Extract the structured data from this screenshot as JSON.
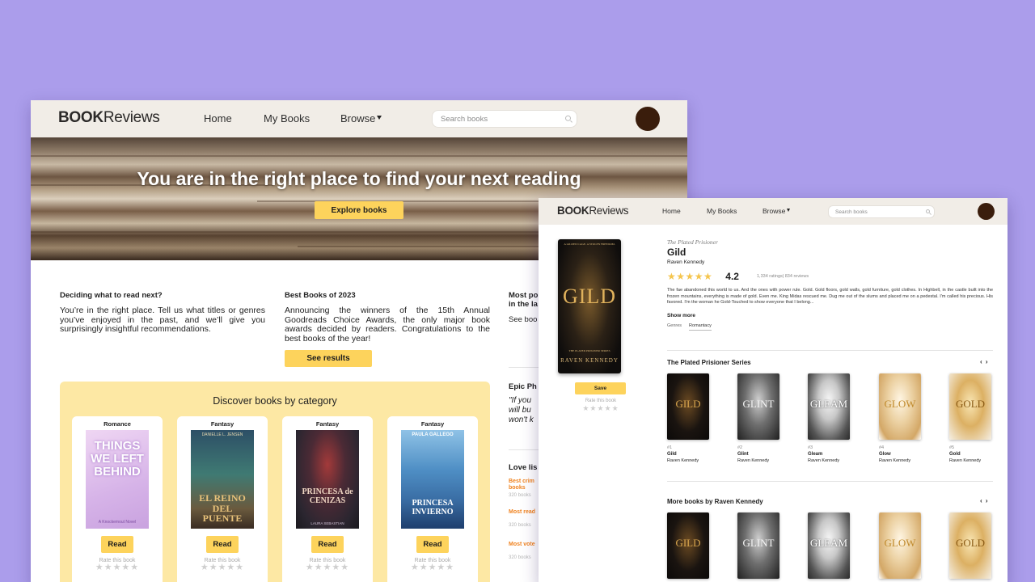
{
  "nav": {
    "logo_bold": "BOOK",
    "logo_rest": "Reviews",
    "home": "Home",
    "my_books": "My Books",
    "browse": "Browse",
    "search_placeholder": "Search books"
  },
  "home": {
    "hero_title": "You are in the right place to find your next reading",
    "explore_button": "Explore books",
    "col1": {
      "heading": "Deciding what to read next?",
      "text": "You’re in the right place. Tell us what titles or genres you’ve enjoyed in the past, and we’ll give you surprisingly insightful recommendations."
    },
    "col2": {
      "heading": "Best Books of 2023",
      "text": "Announcing the winners of the 15th Annual Goodreads Choice Awards, the only major book awards decided by readers. Congratulations to the best books of the year!",
      "button": "See results"
    },
    "col3": {
      "heading": "Most po",
      "heading2": "in the la",
      "text": "See boo"
    },
    "epic": {
      "heading": "Epic Ph",
      "quote1": "\"If you",
      "quote2": "will bu",
      "quote3": "won't k"
    },
    "love": {
      "heading": "Love lis",
      "item1a": "Best crim",
      "item1b": "books",
      "item1c": "320 books",
      "item2a": "Most read",
      "item2c": "320 books",
      "item3a": "Most vote",
      "item3c": "320 books"
    },
    "category": {
      "title": "Discover books by category",
      "read_label": "Read",
      "rate_label": "Rate this book",
      "cards": [
        {
          "genre": "Romance",
          "cover_text": "THINGS WE LEFT BEHIND",
          "cover_sub": "A Knockemout Novel"
        },
        {
          "genre": "Fantasy",
          "cover_text": "EL REINO DEL PUENTE",
          "cover_sub": "DANIELLE L. JENSEN"
        },
        {
          "genre": "Fantasy",
          "cover_text": "PRINCESA de CENIZAS",
          "cover_sub": "LAURA SEBASTIAN"
        },
        {
          "genre": "Fantasy",
          "cover_text": "PRINCESA INVIERNO",
          "cover_sub": "PAULA GALLEGO"
        }
      ]
    }
  },
  "book": {
    "cover_title": "GILD",
    "cover_top": "A GILDED CAGE. A STOLEN FREEDOM.",
    "cover_series": "THE PLATED PRISONER SERIES",
    "cover_author": "RAVEN KENNEDY",
    "save_button": "Save",
    "rate_label": "Rate this book",
    "series": "The Plated Prisioner",
    "title": "Gild",
    "author": "Raven Kennedy",
    "rating": "4.2",
    "rating_stars": 4,
    "counts": "1,334 ratings| 834 reviews",
    "description": "The fae abandoned this world to us. And the ones with power rule. Gold. Gold floors, gold walls, gold furniture, gold clothes. In Highbell, in the castle built into the frozen mountains, everything is made of gold. Even me. King Midas rescued me. Dug me out of the slums and placed me on a pedestal. I'm called his precious. His favored. I'm the woman he Gold-Touched to show everyone that I belong...",
    "show_more": "Show more",
    "genres_label": "Genres",
    "genre1": "Romantacy",
    "series_shelf": "The Plated Prisioner Series",
    "more_shelf": "More books by Raven Kennedy",
    "arrows": "‹ ›",
    "series_books": [
      {
        "num": "#1",
        "title": "Gild",
        "author": "Raven Kennedy",
        "cover": "GILD"
      },
      {
        "num": "#2",
        "title": "Glint",
        "author": "Raven Kennedy",
        "cover": "GLINT"
      },
      {
        "num": "#3",
        "title": "Gleam",
        "author": "Raven Kennedy",
        "cover": "GLEAM"
      },
      {
        "num": "#4",
        "title": "Glow",
        "author": "Raven Kennedy",
        "cover": "GLOW"
      },
      {
        "num": "#5",
        "title": "Gold",
        "author": "Raven Kennedy",
        "cover": "GOLD"
      }
    ],
    "more_books": [
      {
        "cover": "GILD"
      },
      {
        "cover": "GLINT"
      },
      {
        "cover": "GLEAM"
      },
      {
        "cover": "GLOW"
      },
      {
        "cover": "GOLD"
      }
    ]
  },
  "colors": {
    "background": "#ab9deb",
    "nav_bg": "#f1ede7",
    "accent_yellow": "#fdd35c",
    "category_bg": "#fde8a4",
    "avatar": "#3a1d0c",
    "link_orange": "#f0821e",
    "star_gold": "#f5c54d"
  }
}
